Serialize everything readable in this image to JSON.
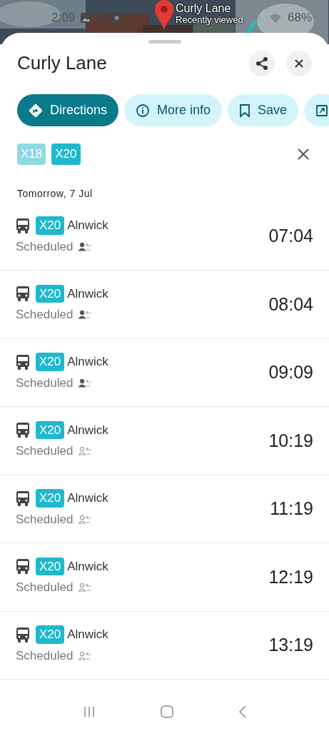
{
  "status_bar": {
    "time": "2:09",
    "battery": "68%"
  },
  "map": {
    "kind": "picture",
    "pin_label": "Curly Lane",
    "pin_sublabel": "Recently viewed"
  },
  "sheet": {
    "title": "Curly Lane"
  },
  "actions": [
    {
      "kind": "directions",
      "label": "Directions",
      "primary": true
    },
    {
      "kind": "info",
      "label": "More info",
      "primary": false
    },
    {
      "kind": "save",
      "label": "Save",
      "primary": false
    },
    {
      "kind": "open",
      "primary": false
    }
  ],
  "route_filters": [
    {
      "label": "X18",
      "selected": false
    },
    {
      "label": "X20",
      "selected": true
    }
  ],
  "date_heading": "Tomorrow, 7 Jul",
  "departures": [
    {
      "route": "X20",
      "destination": "Alnwick",
      "status": "Scheduled",
      "crowded": true,
      "time": "07:04"
    },
    {
      "route": "X20",
      "destination": "Alnwick",
      "status": "Scheduled",
      "crowded": true,
      "time": "08:04"
    },
    {
      "route": "X20",
      "destination": "Alnwick",
      "status": "Scheduled",
      "crowded": true,
      "time": "09:09"
    },
    {
      "route": "X20",
      "destination": "Alnwick",
      "status": "Scheduled",
      "crowded": false,
      "time": "10:19"
    },
    {
      "route": "X20",
      "destination": "Alnwick",
      "status": "Scheduled",
      "crowded": false,
      "time": "11:19"
    },
    {
      "route": "X20",
      "destination": "Alnwick",
      "status": "Scheduled",
      "crowded": false,
      "time": "12:19"
    },
    {
      "route": "X20",
      "destination": "Alnwick",
      "status": "Scheduled",
      "crowded": false,
      "time": "13:19"
    }
  ]
}
